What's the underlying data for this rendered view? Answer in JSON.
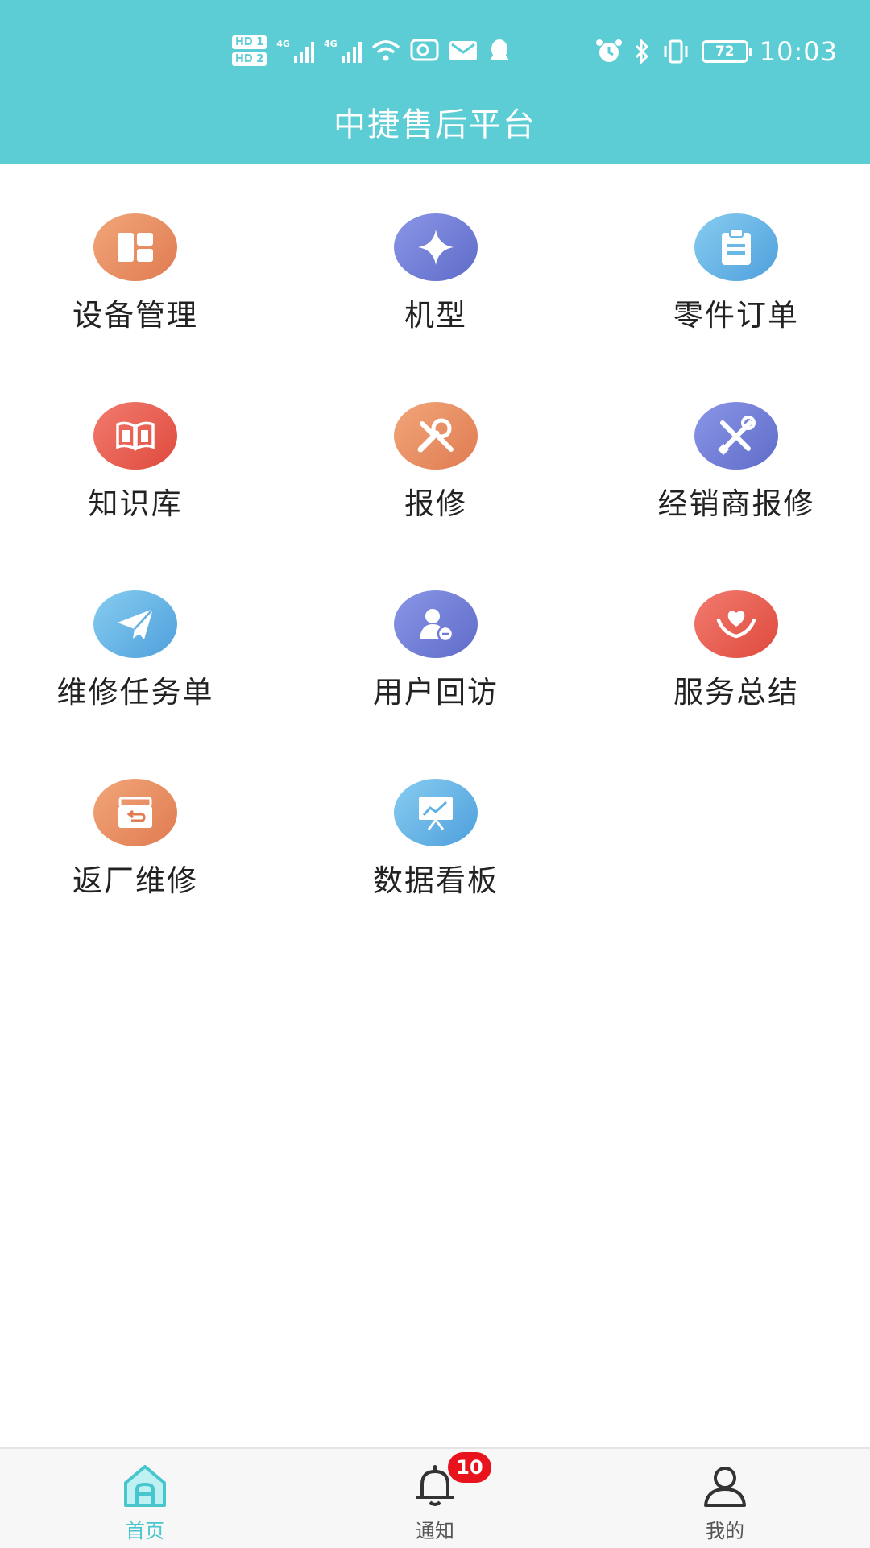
{
  "status_bar": {
    "hd1": "HD 1",
    "hd2": "HD 2",
    "net1": "4G",
    "net2": "4G",
    "battery": "72",
    "time": "10:03"
  },
  "header": {
    "title": "中捷售后平台"
  },
  "grid": [
    {
      "label": "设备管理",
      "icon": "dashboard-icon",
      "color": "#e9885c"
    },
    {
      "label": "机型",
      "icon": "sparkle-icon",
      "color": "#6f7bd6"
    },
    {
      "label": "零件订单",
      "icon": "clipboard-icon",
      "color": "#5eb1e3"
    },
    {
      "label": "知识库",
      "icon": "book-icon",
      "color": "#ea5a4e"
    },
    {
      "label": "报修",
      "icon": "tools-icon",
      "color": "#e9885c"
    },
    {
      "label": "经销商报修",
      "icon": "wrench-screwdriver-icon",
      "color": "#6f7bd6"
    },
    {
      "label": "维修任务单",
      "icon": "paper-plane-icon",
      "color": "#5eb1e3"
    },
    {
      "label": "用户回访",
      "icon": "user-visit-icon",
      "color": "#6f7bd6"
    },
    {
      "label": "服务总结",
      "icon": "heart-hands-icon",
      "color": "#ea5a4e"
    },
    {
      "label": "返厂维修",
      "icon": "return-box-icon",
      "color": "#e9885c"
    },
    {
      "label": "数据看板",
      "icon": "chart-board-icon",
      "color": "#5eb1e3"
    }
  ],
  "tabbar": {
    "home": "首页",
    "notify": "通知",
    "notify_badge": "10",
    "mine": "我的"
  },
  "colors": {
    "header": "#5ccdd4",
    "active_tab": "#48c5cd",
    "badge": "#e8131c"
  }
}
